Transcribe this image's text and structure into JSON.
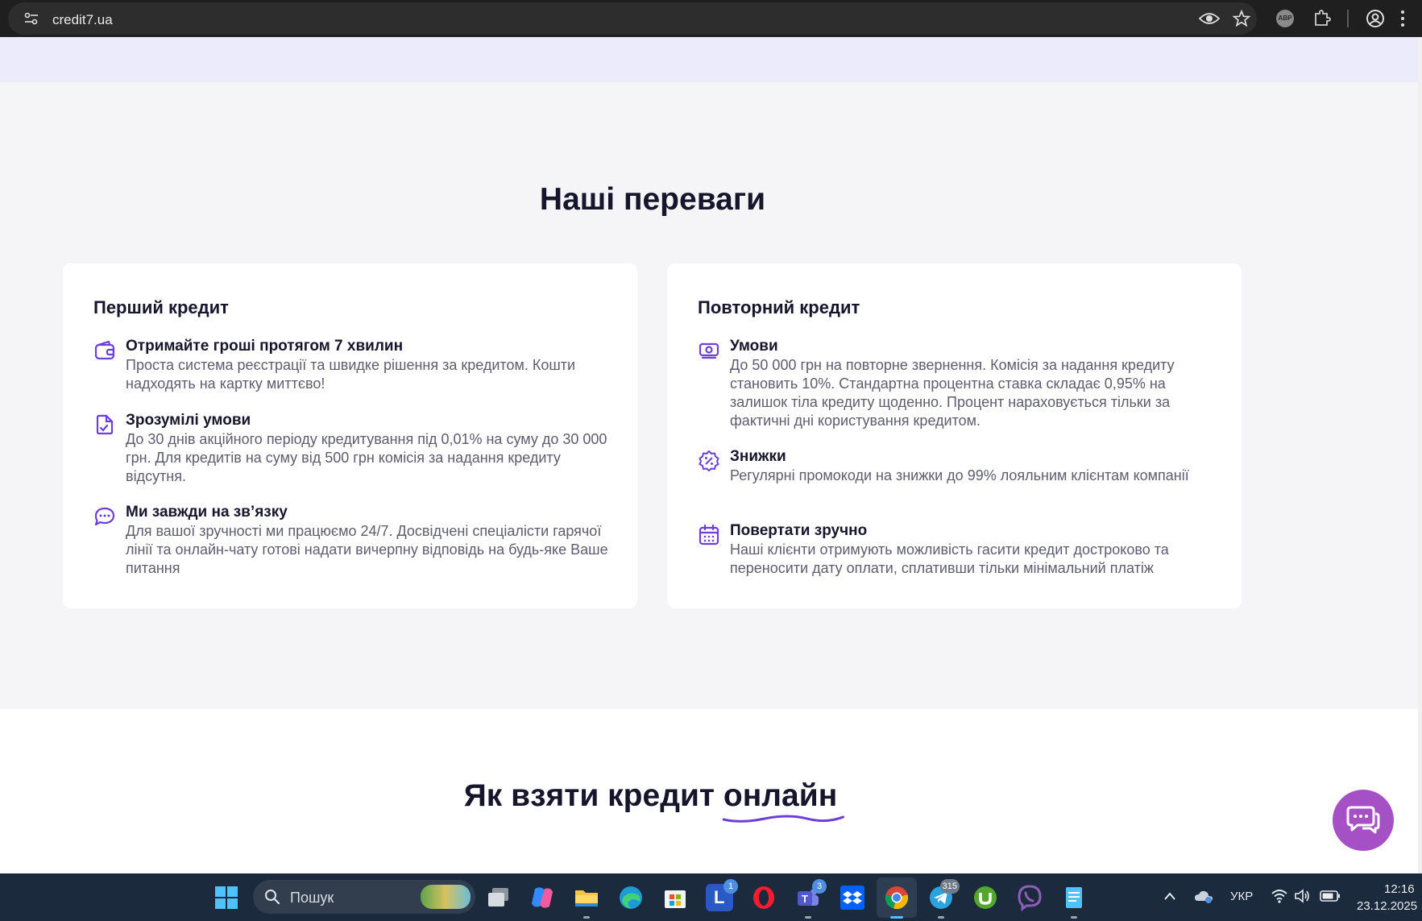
{
  "browser": {
    "url": "credit7.ua",
    "icons": [
      "site-info-icon",
      "eye-icon",
      "star-icon",
      "adblock-icon",
      "puzzle-icon",
      "profile-icon",
      "kebab-menu-icon"
    ],
    "abp_label": "ABP"
  },
  "advantages": {
    "title": "Наші переваги",
    "first_credit": {
      "title": "Перший кредит",
      "features": [
        {
          "icon": "wallet-icon",
          "title": "Отримайте гроші протягом 7 хвилин",
          "desc": "Проста система реєстрації та швидке рішення за кредитом. Кошти надходять на картку миттєво!"
        },
        {
          "icon": "document-check-icon",
          "title": "Зрозумілі умови",
          "desc": "До 30 днів акційного періоду кредитування під 0,01% на суму до 30 000 грн. Для кредитів на суму від 500 грн комісія за надання кредиту відсутня."
        },
        {
          "icon": "chat-bubble-icon",
          "title": "Ми завжди на зв’язку",
          "desc": "Для вашої зручності ми працюємо 24/7. Досвідчені спеціалісти гарячої лінії та онлайн-чату готові надати вичерпну відповідь на будь-яке Ваше питання"
        }
      ]
    },
    "repeat_credit": {
      "title": "Повторний кредит",
      "features": [
        {
          "icon": "money-icon",
          "title": "Умови",
          "desc": "До 50 000 грн на повторне звернення. Комісія за надання кредиту становить 10%. Стандартна процентна ставка складає 0,95% на залишок тіла кредиту щоденно. Процент нараховується тільки за фактичні дні користування кредитом."
        },
        {
          "icon": "discount-badge-icon",
          "title": "Знижки",
          "desc": "Регулярні промокоди на знижки до 99% лояльним клієнтам компанії"
        },
        {
          "icon": "calendar-icon",
          "title": "Повертати зручно",
          "desc": "Наші клієнти отримують можливість гасити кредит достроково та переносити дату оплати, сплативши тільки мінімальний платіж"
        }
      ]
    }
  },
  "how_to": {
    "title_main": "Як взяти кредит",
    "title_accent": "онлайн"
  },
  "chat_widget": {
    "icon": "chat-support-icon"
  },
  "taskbar": {
    "search_placeholder": "Пошук",
    "apps": [
      {
        "name": "windows-start-icon",
        "badge": ""
      },
      {
        "name": "task-view-icon",
        "badge": ""
      },
      {
        "name": "copilot-icon",
        "badge": ""
      },
      {
        "name": "file-explorer-icon",
        "badge": ""
      },
      {
        "name": "edge-icon",
        "badge": ""
      },
      {
        "name": "microsoft-store-icon",
        "badge": ""
      },
      {
        "name": "l-app-icon",
        "badge": "1"
      },
      {
        "name": "opera-icon",
        "badge": ""
      },
      {
        "name": "teams-icon",
        "badge": "3"
      },
      {
        "name": "dropbox-icon",
        "badge": ""
      },
      {
        "name": "chrome-icon",
        "badge": ""
      },
      {
        "name": "telegram-icon",
        "badge": "315"
      },
      {
        "name": "utorrent-icon",
        "badge": ""
      },
      {
        "name": "viber-icon",
        "badge": ""
      },
      {
        "name": "notepad-icon",
        "badge": ""
      }
    ],
    "language": "УКР",
    "time": "12:16",
    "date": "23.12.2025"
  },
  "colors": {
    "accent": "#6b3fd8",
    "chat_fab": "#a551c5",
    "page_bg": "#f5f5f7",
    "top_band": "#ecebfc",
    "taskbar": "#1b2a3c"
  }
}
